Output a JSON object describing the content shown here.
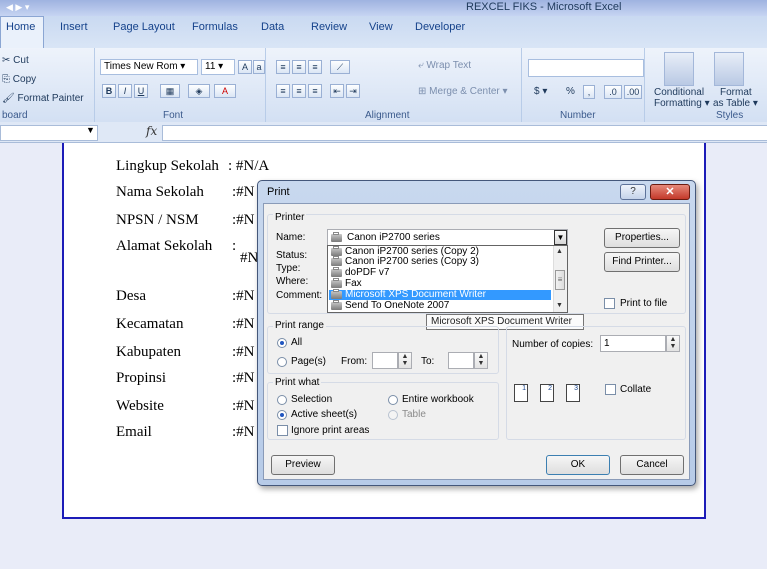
{
  "window": {
    "title": "REXCEL FIKS - Microsoft Excel"
  },
  "tabs": [
    "Home",
    "Insert",
    "Page Layout",
    "Formulas",
    "Data",
    "Review",
    "View",
    "Developer"
  ],
  "ribbon": {
    "clipboard": {
      "cut": "Cut",
      "copy": "Copy",
      "format_painter": "Format Painter",
      "label": "board"
    },
    "font": {
      "name": "Times New Rom",
      "size": "11",
      "label": "Font",
      "bold": "B",
      "italic": "I",
      "underline": "U"
    },
    "alignment": {
      "wrap": "Wrap Text",
      "merge": "Merge & Center",
      "label": "Alignment"
    },
    "number": {
      "format": "",
      "currency": "$",
      "percent": "%",
      "label": "Number"
    },
    "styles": {
      "conditional": "Conditional",
      "formatting": "Formatting",
      "format": "Format",
      "as_table": "as Table",
      "label": "Styles"
    }
  },
  "formula_bar": {
    "fx": "fx",
    "value": ""
  },
  "sheet": {
    "rows": [
      {
        "label": "Lingkup Sekolah",
        "sep": ":",
        "value": "#N/A"
      },
      {
        "label": "Nama Sekolah",
        "sep": ":",
        "value": "#N"
      },
      {
        "label": "NPSN / NSM",
        "sep": ":",
        "value": "#N"
      },
      {
        "label": "Alamat Sekolah",
        "sep": ":",
        "value": "#N"
      },
      {
        "label": "Desa",
        "sep": ":",
        "value": "#N"
      },
      {
        "label": "Kecamatan",
        "sep": ":",
        "value": "#N"
      },
      {
        "label": "Kabupaten",
        "sep": ":",
        "value": "#N"
      },
      {
        "label": "Propinsi",
        "sep": ":",
        "value": "#N"
      },
      {
        "label": "Website",
        "sep": ":",
        "value": "#N"
      },
      {
        "label": "Email",
        "sep": ":",
        "value": "#N"
      }
    ]
  },
  "dialog": {
    "title": "Print",
    "printer_group": "Printer",
    "name_label": "Name:",
    "selected_printer": "Canon iP2700 series",
    "status_label": "Status:",
    "type_label": "Type:",
    "where_label": "Where:",
    "comment_label": "Comment:",
    "printer_list": [
      "Canon iP2700 series (Copy 2)",
      "Canon iP2700 series (Copy 3)",
      "doPDF v7",
      "Fax",
      "Microsoft XPS Document Writer",
      "Send To OneNote 2007"
    ],
    "selected_index": 4,
    "tooltip": "Microsoft XPS Document Writer",
    "properties": "Properties...",
    "find_printer": "Find Printer...",
    "print_to_file": "Print to file",
    "print_range": "Print range",
    "all": "All",
    "pages": "Page(s)",
    "from": "From:",
    "to": "To:",
    "print_what": "Print what",
    "selection": "Selection",
    "entire_workbook": "Entire workbook",
    "active_sheets": "Active sheet(s)",
    "table": "Table",
    "ignore_print_areas": "Ignore print areas",
    "copies_label": "Number of copies:",
    "copies_value": "1",
    "collate": "Collate",
    "preview": "Preview",
    "ok": "OK",
    "cancel": "Cancel"
  }
}
